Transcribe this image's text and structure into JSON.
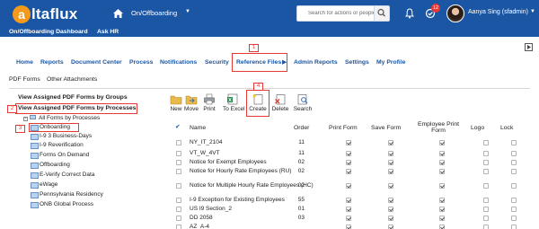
{
  "header": {
    "logo_letter": "a",
    "logo_text": "ltaflux",
    "module": "On/Offboarding",
    "search_placeholder": "Search for actions or people",
    "notification_count": "12",
    "user": "Aanya Sing (sfadmin)"
  },
  "subnav": [
    "On/Offboarding Dashboard",
    "Ask HR"
  ],
  "nav": [
    "Home",
    "Reports",
    "Document Center",
    "Process",
    "Notifications",
    "Security",
    "Reference Files",
    "Admin Reports",
    "Settings",
    "My Profile"
  ],
  "tabs": [
    "PDF Forms",
    "Other Attachments"
  ],
  "callouts": [
    "1",
    "2",
    "3",
    "4"
  ],
  "left_panel": {
    "groups_title": "View Assigned PDF Forms by Groups",
    "processes_title": "View Assigned PDF Forms by Processes",
    "tree_root": "All Forms by Processes",
    "tree_items": [
      "Onboarding",
      "I-9 3 Business-Days",
      "I-9 Reverification",
      "Forms On Demand",
      "Offboarding",
      "E-Verify Correct Data",
      "eWage",
      "Pennsylvania Residency",
      "ONB Global Process"
    ]
  },
  "toolbar": [
    "New",
    "Move",
    "Print",
    "To Excel",
    "Create",
    "Delete",
    "Search"
  ],
  "table": {
    "check_header": "✔",
    "headers": [
      "Name",
      "Order",
      "Print Form",
      "Save Form",
      "Employee Print Form",
      "Logo",
      "Lock"
    ],
    "rows": [
      {
        "name": "NY_IT_2104",
        "order": "11",
        "print": true,
        "save": true,
        "emp": true,
        "logo": false,
        "lock": false
      },
      {
        "name": "VT_W_4VT",
        "order": "11",
        "print": true,
        "save": true,
        "emp": true,
        "logo": false,
        "lock": false
      },
      {
        "name": "Notice for Exempt Employees",
        "order": "02",
        "print": true,
        "save": true,
        "emp": true,
        "logo": false,
        "lock": false
      },
      {
        "name": "Notice for Hourly Rate Employees (RU)",
        "order": "02",
        "print": true,
        "save": true,
        "emp": true,
        "logo": false,
        "lock": false
      },
      {
        "name": "Notice for Multiple Hourly Rate Employees (HC)",
        "order": "02",
        "print": true,
        "save": true,
        "emp": true,
        "logo": false,
        "lock": false
      },
      {
        "name": "I-9 Exception for Existing Employees",
        "order": "55",
        "print": true,
        "save": true,
        "emp": true,
        "logo": false,
        "lock": false
      },
      {
        "name": "US I9 Section_2",
        "order": "01",
        "print": true,
        "save": true,
        "emp": true,
        "logo": false,
        "lock": false
      },
      {
        "name": "DD 2058",
        "order": "03",
        "print": true,
        "save": true,
        "emp": true,
        "logo": false,
        "lock": false
      },
      {
        "name": "AZ_A-4",
        "order": "",
        "print": true,
        "save": true,
        "emp": true,
        "logo": false,
        "lock": false
      }
    ]
  },
  "colors": {
    "brand_blue": "#1a56a4",
    "accent_orange": "#f39a1c",
    "annotation_red": "#e53935"
  }
}
